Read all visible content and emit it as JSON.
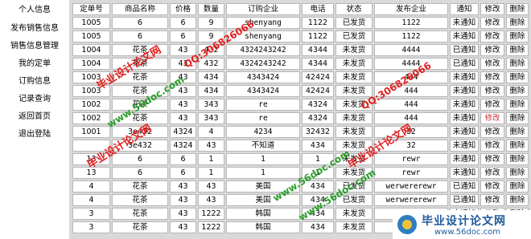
{
  "sidebar": {
    "items": [
      {
        "label": "个人信息"
      },
      {
        "label": "发布销售信息"
      },
      {
        "label": "销售信息管理"
      },
      {
        "label": "我的定单"
      },
      {
        "label": "订购信息"
      },
      {
        "label": "记录查询"
      },
      {
        "label": "返回首页"
      },
      {
        "label": "退出登陆"
      }
    ]
  },
  "table": {
    "headers": [
      "定单号",
      "商品名称",
      "价格",
      "数量",
      "订购企业",
      "电话",
      "状态",
      "发布企业",
      "通知",
      "修改",
      "删除"
    ],
    "rows": [
      [
        "1005",
        "6",
        "6",
        "9",
        "shenyang",
        "1122",
        "已发货",
        "1122",
        "未通知",
        "修改",
        "删除"
      ],
      [
        "1005",
        "6",
        "6",
        "9",
        "shenyang",
        "1122",
        "已发货",
        "1122",
        "未通知",
        "修改",
        "删除"
      ],
      [
        "1004",
        "花茶",
        "43",
        "432",
        "4324243242",
        "4344",
        "未发货",
        "4444",
        "已通知",
        "修改",
        "删除"
      ],
      [
        "1004",
        "花茶",
        "43",
        "432",
        "4324243242",
        "4344",
        "未发货",
        "4444",
        "已通知",
        "修改",
        "删除"
      ],
      [
        "1003",
        "花茶",
        "43",
        "434",
        "4343424",
        "42424",
        "未发货",
        "444",
        "未通知",
        "修改",
        "删除"
      ],
      [
        "1003",
        "花茶",
        "43",
        "434",
        "4343424",
        "42424",
        "未发货",
        "444",
        "未通知",
        "修改",
        "删除"
      ],
      [
        "1002",
        "花茶",
        "43",
        "343",
        "re",
        "4324",
        "未发货",
        "444",
        "未通知",
        "修改",
        "删除"
      ],
      [
        "1002",
        "花茶",
        "43",
        "343",
        "re",
        "4324",
        "未发货",
        "444",
        "未通知",
        "修改",
        "删除"
      ],
      [
        "1001",
        "3e432",
        "4324",
        "4",
        "4234",
        "32432",
        "未发货",
        "32",
        "未通知",
        "修改",
        "删除"
      ],
      [
        "",
        "3e432",
        "4324",
        "43",
        "不知道",
        "434",
        "未发货",
        "32",
        "未通知",
        "修改",
        "删除"
      ],
      [
        "13",
        "6",
        "6",
        "1",
        "1",
        "1",
        "未发货",
        "rewr",
        "未通知",
        "修改",
        "删除"
      ],
      [
        "13",
        "6",
        "6",
        "1",
        "1",
        "1",
        "未发货",
        "rewr",
        "未通知",
        "修改",
        "删除"
      ],
      [
        "4",
        "花茶",
        "43",
        "43",
        "美国",
        "434",
        "已发货",
        "werwererewr",
        "已通知",
        "修改",
        "删除"
      ],
      [
        "4",
        "花茶",
        "43",
        "43",
        "美国",
        "434",
        "已发货",
        "werwererewr",
        "已通知",
        "修改",
        "删除"
      ],
      [
        "3",
        "花茶",
        "43",
        "1222",
        "韩国",
        "434",
        "未发货",
        "rewr",
        "未通知",
        "修改",
        "删除"
      ],
      [
        "3",
        "花茶",
        "43",
        "1222",
        "韩国",
        "434",
        "未发货",
        "rewr",
        "未通知",
        "修改",
        "删除"
      ]
    ]
  },
  "watermarks": {
    "brand_cn": "毕业设计论文网",
    "qq": "QQ:306826066",
    "site": "www.56doc.com"
  },
  "brand": {
    "title": "毕业设计论文网",
    "url": "www.56doc.com"
  },
  "colors": {
    "watermark_red": "#e21f1f",
    "watermark_green": "#2a9d2a",
    "hover_link": "#cc3333",
    "brand_blue": "#1f5a9c",
    "main_bg": "#d9d9d9"
  }
}
